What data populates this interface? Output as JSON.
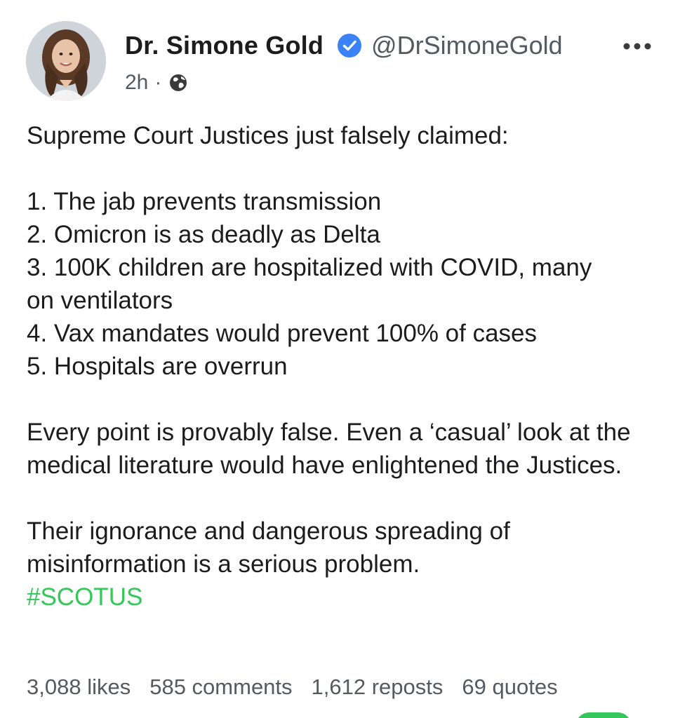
{
  "author": {
    "name": "Dr. Simone Gold",
    "handle": "@DrSimoneGold",
    "time": "2h",
    "separator": "·",
    "visibility_icon": "globe-icon",
    "verified_icon": "verified-badge-icon"
  },
  "post": {
    "intro": "Supreme Court Justices just falsely claimed:",
    "items": [
      "1. The jab prevents transmission",
      "2. Omicron is as deadly as Delta",
      "3. 100K children are hospitalized with COVID, many on ventilators",
      "4. Vax mandates would prevent 100% of cases",
      "5. Hospitals are overrun"
    ],
    "paragraph2": "Every point is provably false. Even a ‘casual’ look at the medical literature would have enlightened the Justices.",
    "paragraph3": "Their ignorance and dangerous spreading of misinformation is a serious problem.",
    "hashtag": "#SCOTUS"
  },
  "stats": {
    "likes": "3,088 likes",
    "comments": "585 comments",
    "reposts": "1,612 reposts",
    "quotes": "69 quotes"
  },
  "colors": {
    "verified": "#3b82f6",
    "hashtag": "#34c759",
    "secondary_text": "#555a60"
  },
  "icons": {
    "more": "more-options-icon"
  }
}
